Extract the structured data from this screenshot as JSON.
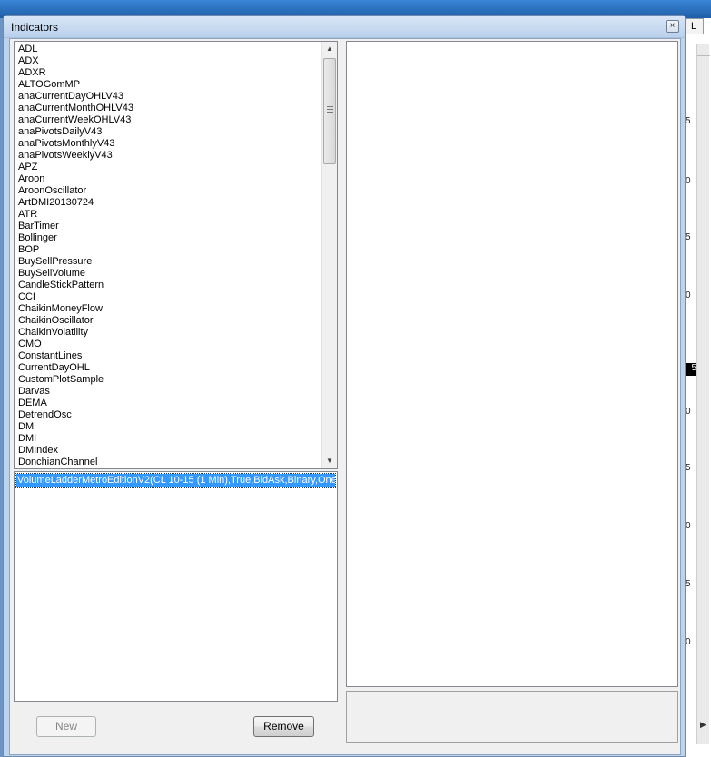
{
  "window": {
    "title": "Indicators",
    "close_glyph": "×"
  },
  "background": {
    "tab_label": "L",
    "scale_labels": [
      "5",
      "0",
      "5",
      "0",
      "5",
      "0",
      "5",
      "0",
      "5",
      "0"
    ],
    "highlight_label": "5"
  },
  "indicators": [
    "ADL",
    "ADX",
    "ADXR",
    "ALTOGomMP",
    "anaCurrentDayOHLV43",
    "anaCurrentMonthOHLV43",
    "anaCurrentWeekOHLV43",
    "anaPivotsDailyV43",
    "anaPivotsMonthlyV43",
    "anaPivotsWeeklyV43",
    "APZ",
    "Aroon",
    "AroonOscillator",
    "ArtDMI20130724",
    "ATR",
    "BarTimer",
    "Bollinger",
    "BOP",
    "BuySellPressure",
    "BuySellVolume",
    "CandleStickPattern",
    "CCI",
    "ChaikinMoneyFlow",
    "ChaikinOscillator",
    "ChaikinVolatility",
    "CMO",
    "ConstantLines",
    "CurrentDayOHL",
    "CustomPlotSample",
    "Darvas",
    "DEMA",
    "DetrendOsc",
    "DM",
    "DMI",
    "DMIndex",
    "DonchianChannel"
  ],
  "applied": {
    "selected_item": "VolumeLadderMetroEditionV2(CL 10-15 (1 Min),True,BidAsk,Binary,OnePe"
  },
  "buttons": {
    "new_label": "New",
    "remove_label": "Remove"
  },
  "scroll": {
    "up_glyph": "▲",
    "down_glyph": "▼"
  }
}
